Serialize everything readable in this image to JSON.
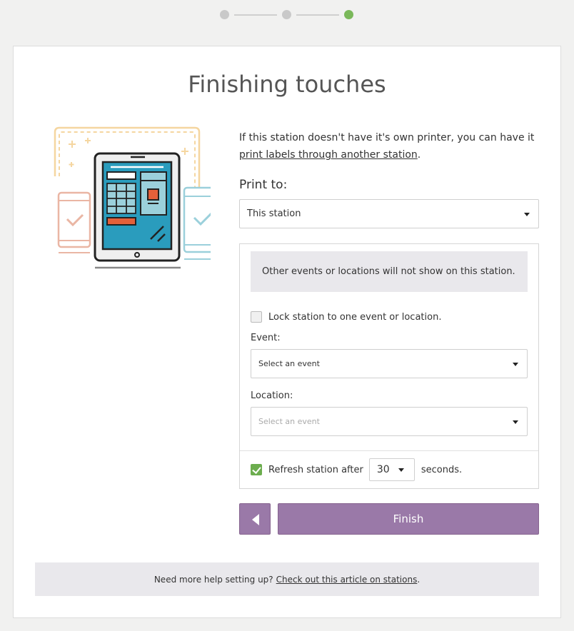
{
  "steps": {
    "total": 3,
    "current": 3
  },
  "colors": {
    "accent": "#9a79a8",
    "step_active": "#7ab85a",
    "check": "#6cad4e"
  },
  "title": "Finishing touches",
  "intro": {
    "text": "If this station doesn't have it's own printer, you can have it",
    "link": "print labels through another station",
    "end": "."
  },
  "print_to": {
    "label": "Print to:",
    "value": "This station"
  },
  "panel": {
    "notice": "Other events or locations will not show on this station.",
    "lock_label": "Lock station to one event or location.",
    "event_label": "Event:",
    "event_value": "Select an event",
    "location_label": "Location:",
    "location_value": "Select an event",
    "refresh_label": "Refresh station after",
    "refresh_value": "30",
    "refresh_suffix": "seconds."
  },
  "buttons": {
    "back_icon": "chevron-left-icon",
    "finish": "Finish"
  },
  "help": {
    "text": "Need more help setting up?",
    "link": "Check out this article on stations",
    "end": "."
  }
}
